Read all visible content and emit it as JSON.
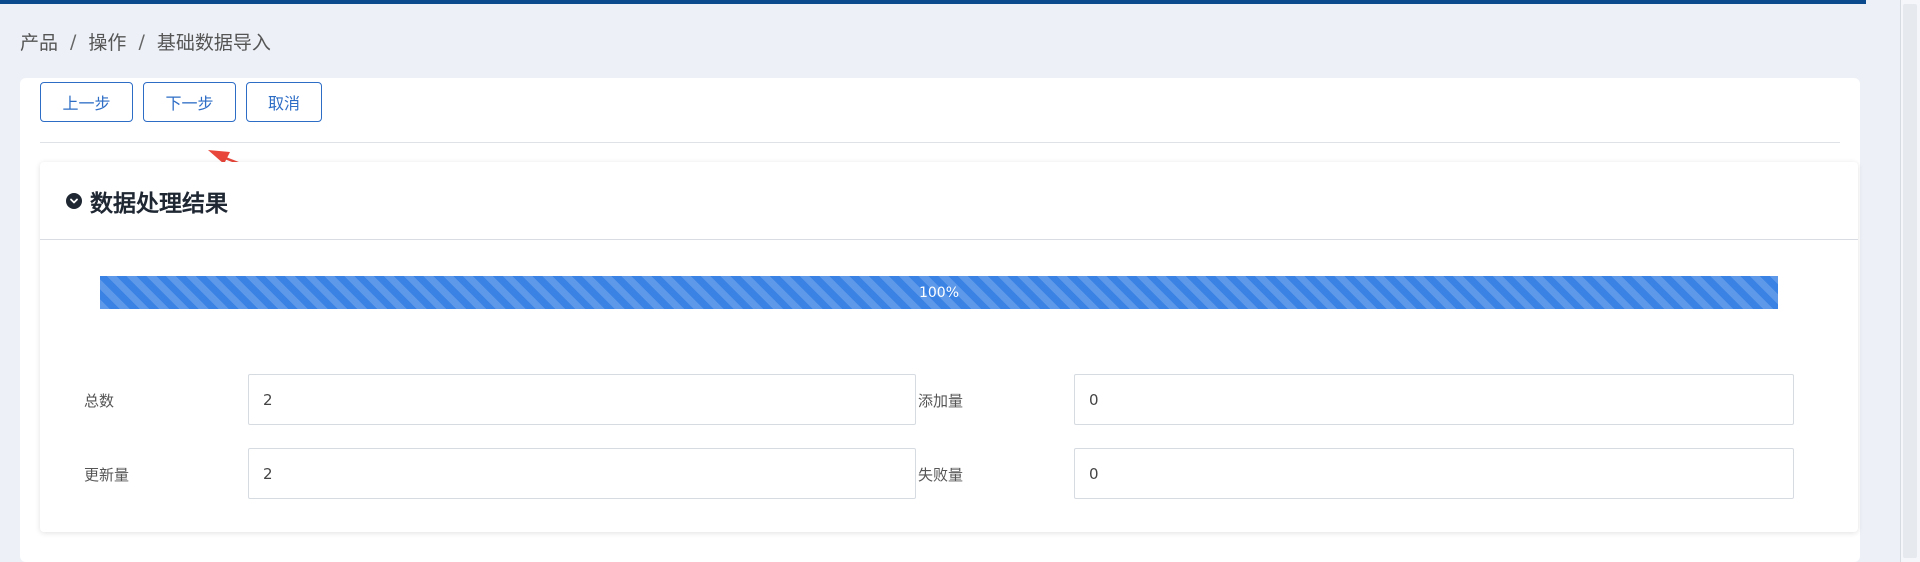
{
  "breadcrumb": {
    "items": [
      "产品",
      "操作",
      "基础数据导入"
    ],
    "separator": "/"
  },
  "toolbar": {
    "prev_label": "上一步",
    "next_label": "下一步",
    "cancel_label": "取消"
  },
  "panel": {
    "title": "数据处理结果",
    "progress_label": "100%",
    "progress_value": 100
  },
  "fields": {
    "total_label": "总数",
    "total_value": "2",
    "added_label": "添加量",
    "added_value": "0",
    "updated_label": "更新量",
    "updated_value": "2",
    "failed_label": "失败量",
    "failed_value": "0"
  },
  "colors": {
    "accent": "#2e6dc6",
    "progress": "#3a82e4",
    "topbar": "#0b4a8c",
    "annotation_arrow": "#e8463a"
  }
}
